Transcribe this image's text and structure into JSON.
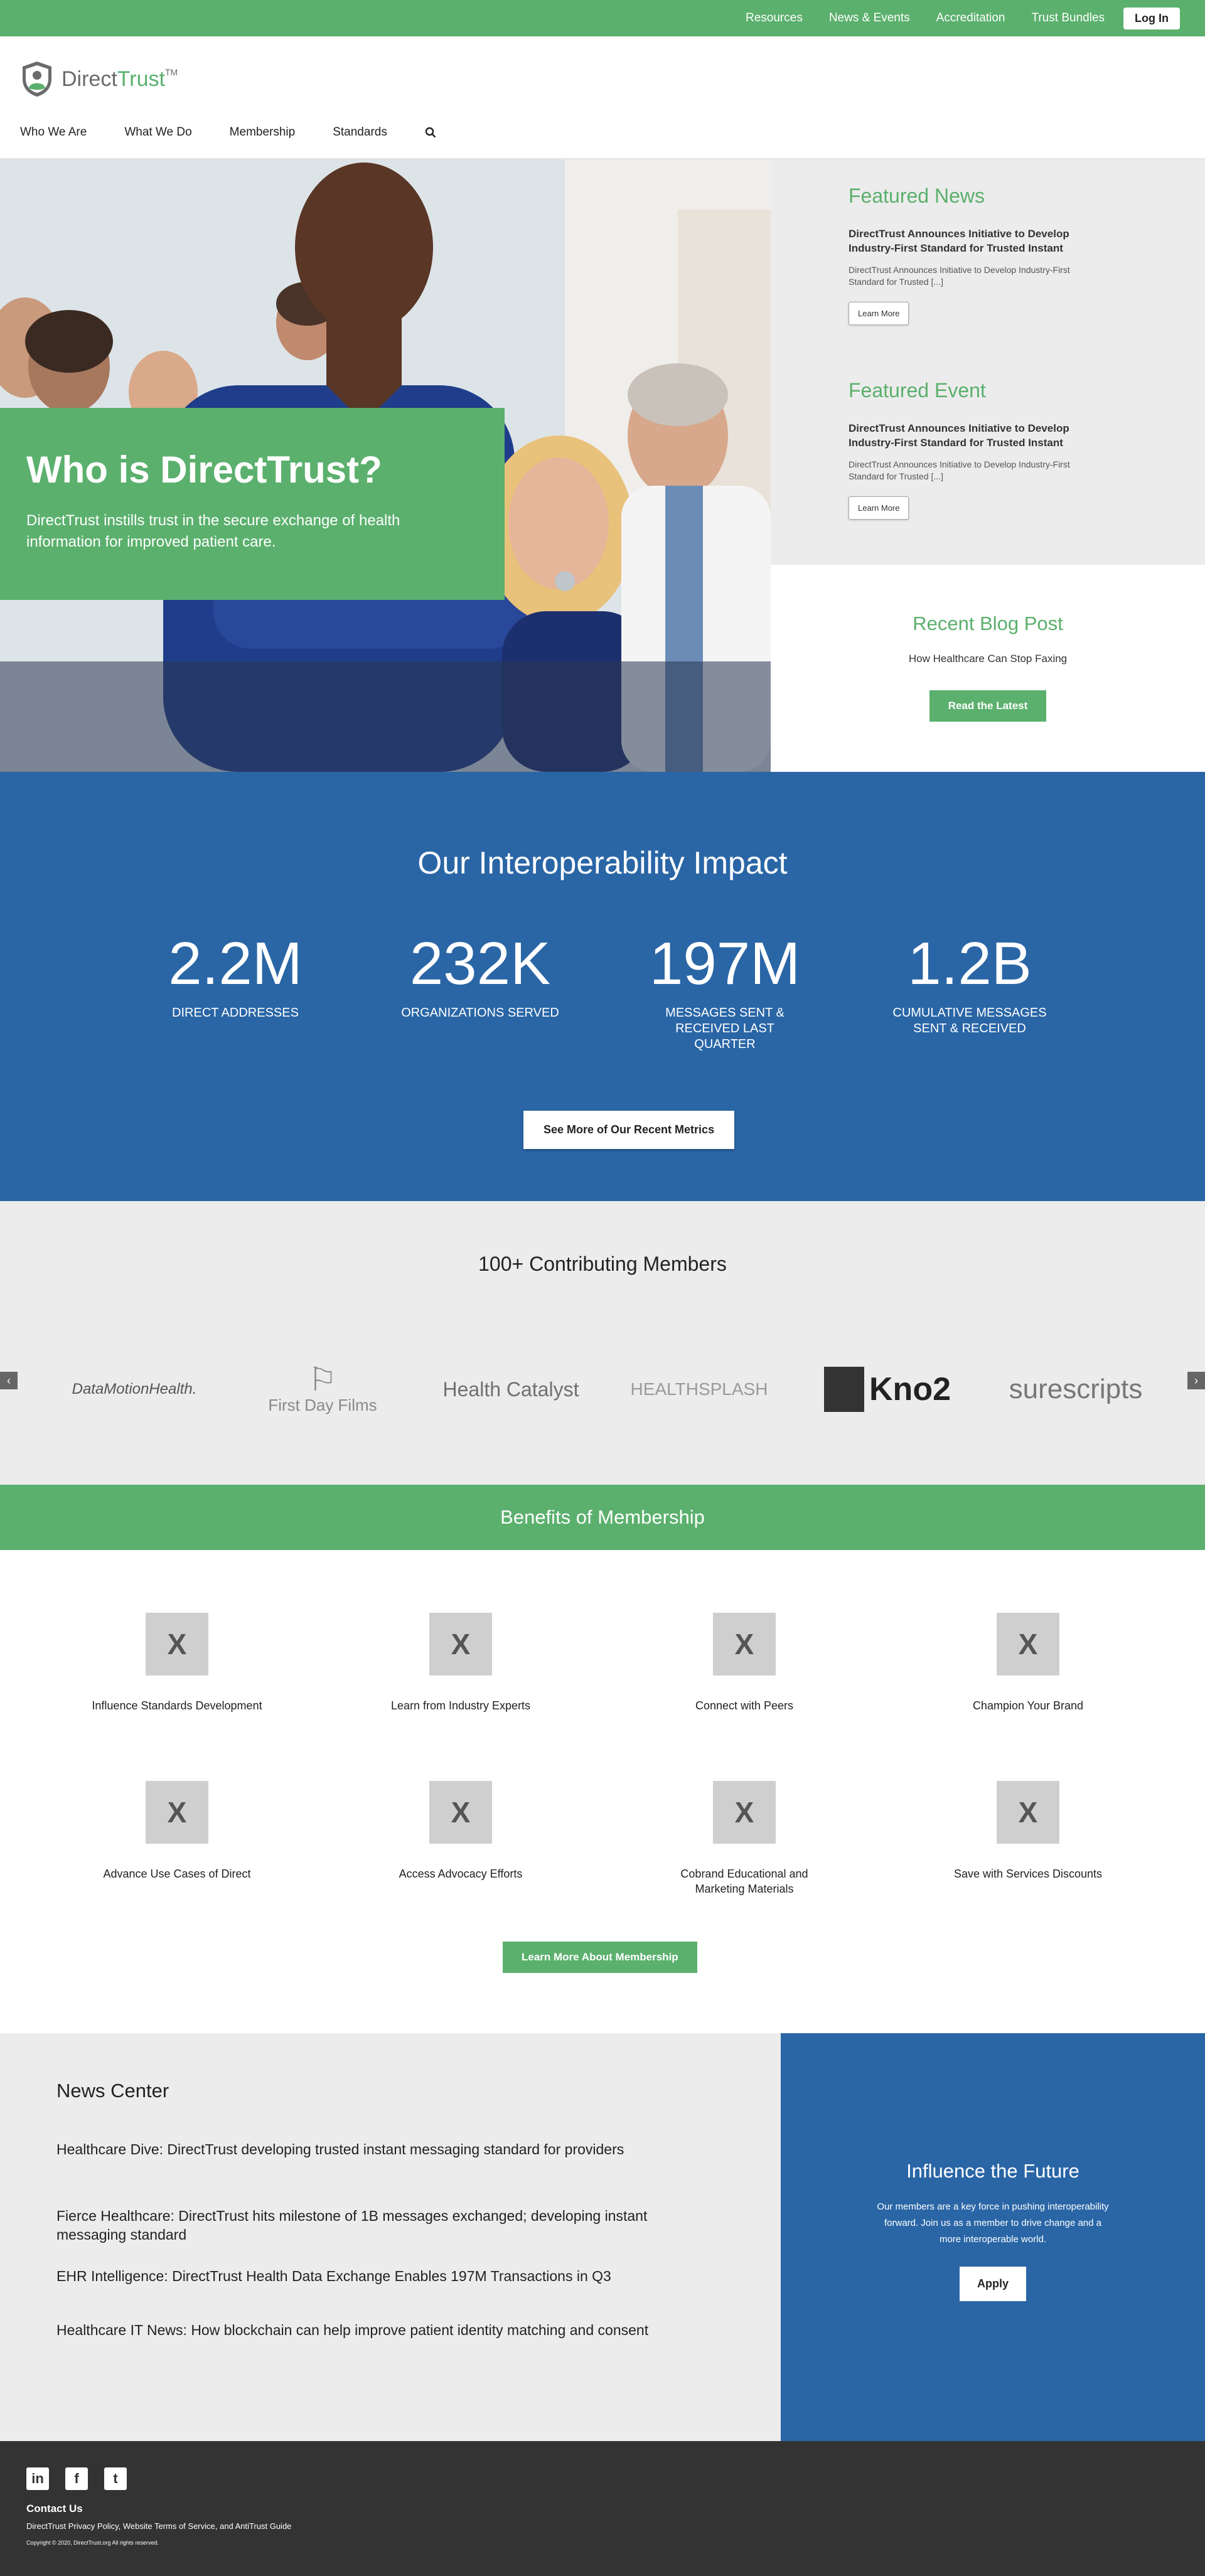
{
  "topbar": {
    "links": [
      "Resources",
      "News & Events",
      "Accreditation",
      "Trust Bundles"
    ],
    "login_label": "Log In",
    "bg_color": "#5bb06d"
  },
  "header": {
    "logo_text_1": "Direct",
    "logo_text_2": "Trust",
    "logo_tm": "TM",
    "nav": [
      "Who We Are",
      "What We Do",
      "Membership",
      "Standards"
    ],
    "search_icon": "search-icon"
  },
  "hero": {
    "title": "Who is DirectTrust?",
    "text": "DirectTrust instills trust in the secure exchange of health information for improved patient care."
  },
  "featured_news": {
    "heading": "Featured News",
    "title": "DirectTrust Announces Initiative to Develop Industry-First Standard for Trusted Instant",
    "excerpt": "DirectTrust Announces Initiative to Develop Industry-First Standard for Trusted [...]",
    "button": "Learn More"
  },
  "featured_event": {
    "heading": "Featured Event",
    "title": "DirectTrust Announces Initiative to Develop Industry-First Standard for Trusted Instant",
    "excerpt": "DirectTrust Announces Initiative to Develop Industry-First Standard for Trusted [...]",
    "button": "Learn More"
  },
  "blog": {
    "heading": "Recent Blog Post",
    "title": "How Healthcare Can Stop Faxing",
    "button": "Read the Latest"
  },
  "impact": {
    "heading": "Our Interoperability Impact",
    "stats": [
      {
        "num": "2.2M",
        "label": "DIRECT ADDRESSES"
      },
      {
        "num": "232K",
        "label": "ORGANIZATIONS SERVED"
      },
      {
        "num": "197M",
        "label": "MESSAGES SENT & RECEIVED LAST QUARTER"
      },
      {
        "num": "1.2B",
        "label": "CUMULATIVE MESSAGES SENT & RECEIVED"
      }
    ],
    "button": "See More of Our Recent Metrics"
  },
  "members": {
    "heading": "100+ Contributing Members",
    "logos": [
      "DataMotionHealth.",
      "First Day Films",
      "Health Catalyst",
      "HEALTHSPLASH",
      "Kno2",
      "surescripts"
    ],
    "prev": "‹",
    "next": "›"
  },
  "benefits": {
    "heading": "Benefits of Membership",
    "placeholder": "X",
    "items": [
      "Influence Standards Development",
      "Learn from Industry Experts",
      "Connect with Peers",
      "Champion Your Brand",
      "Advance Use Cases of Direct",
      "Access Advocacy Efforts",
      "Cobrand Educational and Marketing Materials",
      "Save with Services Discounts"
    ],
    "button": "Learn More About Membership"
  },
  "news": {
    "heading": "News Center",
    "items": [
      "Healthcare Dive: DirectTrust developing trusted instant messaging standard for providers",
      "Fierce Healthcare: DirectTrust hits milestone of 1B messages exchanged; developing instant messaging standard",
      "EHR Intelligence: DirectTrust Health Data Exchange Enables 197M Transactions in Q3",
      "Healthcare IT News: How blockchain can help improve patient identity matching and consent"
    ]
  },
  "influence": {
    "heading": "Influence the Future",
    "text": "Our members are a key force in pushing interoperability forward.  Join us as a member to drive change and a more interoperable world.",
    "button": "Apply"
  },
  "footer": {
    "social": [
      "in",
      "f",
      "t"
    ],
    "contact": "Contact Us",
    "legal": "DirectTrust Privacy Policy, Website Terms of Service, and AntiTrust Guide",
    "copyright": "Copyright © 2020, DirectTrust.org All rights reserved."
  }
}
